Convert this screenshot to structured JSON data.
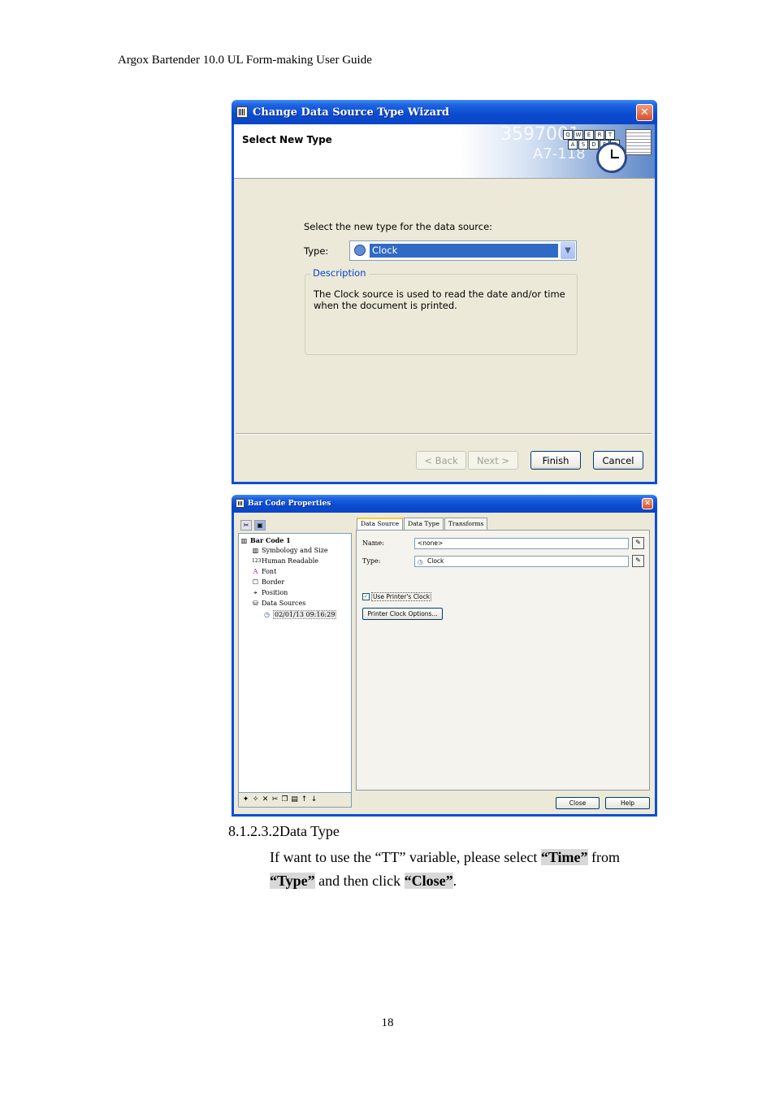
{
  "header": {
    "title": "Argox Bartender 10.0 UL Form-making User Guide"
  },
  "wizard": {
    "title": "Change Data Source Type Wizard",
    "heading": "Select New Type",
    "banner": {
      "number1": "3597001",
      "number2": "A7-118",
      "keys_row1": [
        "Q",
        "W",
        "E",
        "R",
        "T"
      ],
      "keys_row2": [
        "A",
        "S",
        "D",
        "F",
        "G"
      ]
    },
    "instruction": "Select the new type for the data source:",
    "type_label": "Type:",
    "type_value": "Clock",
    "description_legend": "Description",
    "description_text": "The Clock source is used to read the date and/or time when the document is printed.",
    "buttons": {
      "back": "< Back",
      "next": "Next >",
      "finish": "Finish",
      "cancel": "Cancel"
    },
    "icons": {
      "close": "close-icon",
      "clock": "clock-icon",
      "dropdown": "chevron-down-icon"
    }
  },
  "barcode_properties": {
    "title": "Bar Code Properties",
    "tree": {
      "root": "Bar Code 1",
      "items": [
        "Symbology and Size",
        "Human Readable",
        "Font",
        "Border",
        "Position",
        "Data Sources"
      ],
      "selected": "02/01/13 09:16:29",
      "icons": [
        "symbology-icon",
        "human-readable-icon",
        "font-icon",
        "border-icon",
        "position-icon",
        "data-sources-icon",
        "clock-icon"
      ]
    },
    "tabs": [
      "Data Source",
      "Data Type",
      "Transforms"
    ],
    "name_label": "Name:",
    "name_value": "<none>",
    "type_label": "Type:",
    "type_value": "Clock",
    "checkbox_label": "Use Printer's Clock",
    "checkbox_checked": true,
    "options_button": "Printer Clock Options...",
    "close_button": "Close",
    "help_button": "Help"
  },
  "section": {
    "title": "8.1.2.3.2Data Type",
    "text_pre": "If want to use the “TT” variable, please select ",
    "hl_time": "“Time”",
    "text_mid1": " from",
    "hl_type": "“Type”",
    "text_mid2": " and then click ",
    "hl_close": "“Close”",
    "text_end": "."
  },
  "page_number": "18"
}
